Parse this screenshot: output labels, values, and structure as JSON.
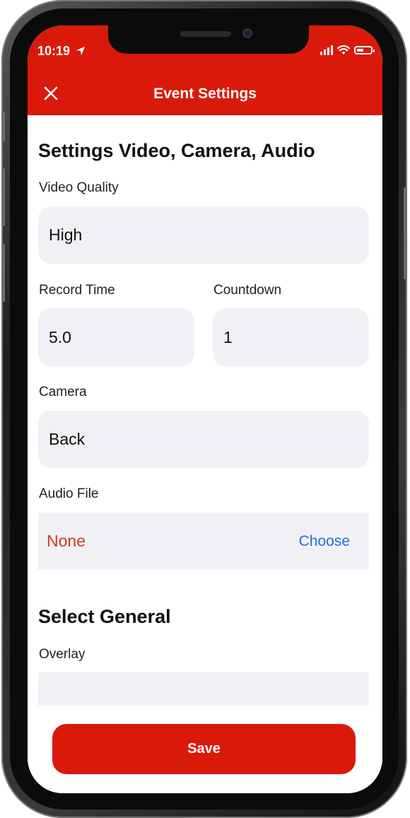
{
  "status_bar": {
    "time": "10:19"
  },
  "header": {
    "title": "Event Settings",
    "close_icon": "close-icon"
  },
  "section_video": {
    "title": "Settings Video, Camera, Audio",
    "video_quality": {
      "label": "Video Quality",
      "value": "High"
    },
    "record_time": {
      "label": "Record Time",
      "value": "5.0"
    },
    "countdown": {
      "label": "Countdown",
      "value": "1"
    },
    "camera": {
      "label": "Camera",
      "value": "Back"
    },
    "audio_file": {
      "label": "Audio File",
      "value": "None",
      "choose_label": "Choose"
    }
  },
  "section_general": {
    "title": "Select General",
    "overlay": {
      "label": "Overlay",
      "value": ""
    }
  },
  "footer": {
    "save_label": "Save"
  },
  "colors": {
    "brand_red": "#d91a0a",
    "link_blue": "#1a73d9",
    "none_red": "#cc3a1a",
    "field_bg": "#f1f1f5"
  }
}
